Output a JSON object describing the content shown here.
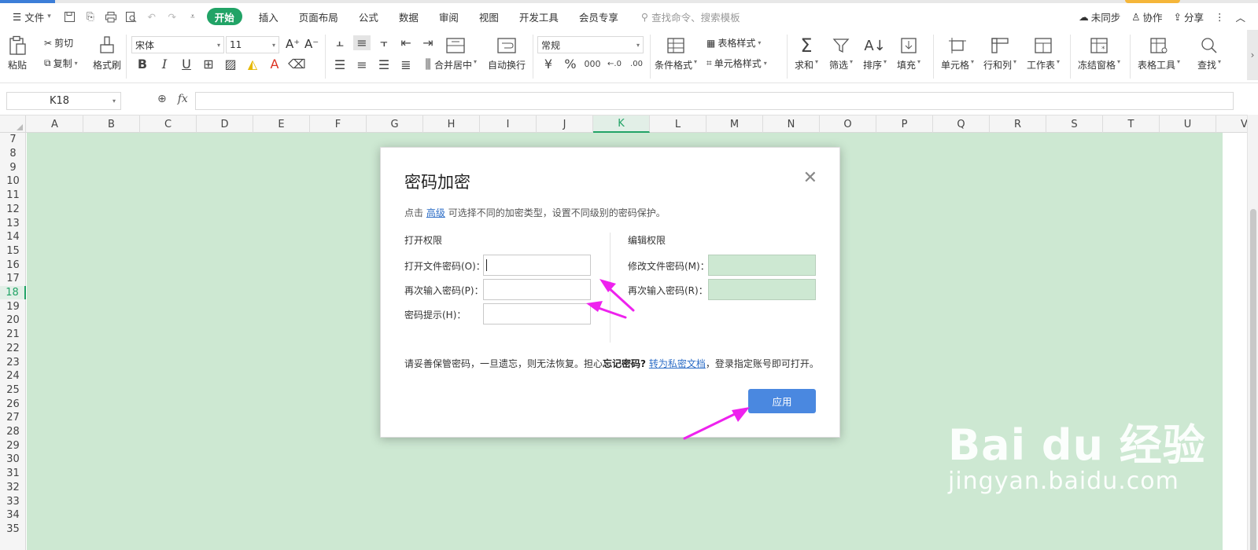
{
  "menu": {
    "file_label": "文件",
    "tabs": [
      "开始",
      "插入",
      "页面布局",
      "公式",
      "数据",
      "审阅",
      "视图",
      "开发工具",
      "会员专享"
    ],
    "search_placeholder": "查找命令、搜索模板",
    "sync_label": "未同步",
    "collab_label": "协作",
    "share_label": "分享"
  },
  "ribbon": {
    "paste": "粘贴",
    "cut": "剪切",
    "copy": "复制",
    "format_painter": "格式刷",
    "font_name": "宋体",
    "font_size": "11",
    "merge_center": "合并居中",
    "wrap_text": "自动换行",
    "number_format": "常规",
    "conditional_format": "条件格式",
    "table_style": "表格样式",
    "cell_style": "单元格样式",
    "sum": "求和",
    "filter": "筛选",
    "sort": "排序",
    "fill": "填充",
    "cell": "单元格",
    "rows_cols": "行和列",
    "worksheet": "工作表",
    "freeze": "冻结窗格",
    "table_tools": "表格工具",
    "find": "查找"
  },
  "formula_bar": {
    "name_box": "K18",
    "fx": "fx",
    "formula": ""
  },
  "grid": {
    "columns": [
      "A",
      "B",
      "C",
      "D",
      "E",
      "F",
      "G",
      "H",
      "I",
      "J",
      "K",
      "L",
      "M",
      "N",
      "O",
      "P",
      "Q",
      "R",
      "S",
      "T",
      "U",
      "V"
    ],
    "rows": [
      "7",
      "8",
      "9",
      "10",
      "11",
      "12",
      "13",
      "14",
      "15",
      "16",
      "17",
      "18",
      "19",
      "20",
      "21",
      "22",
      "23",
      "24",
      "25",
      "26",
      "27",
      "28",
      "29",
      "30",
      "31",
      "32",
      "33",
      "34",
      "35"
    ],
    "selected_column": "K",
    "selected_row": "18"
  },
  "dialog": {
    "title": "密码加密",
    "subtitle_prefix": "点击",
    "subtitle_link": "高级",
    "subtitle_suffix": "可选择不同的加密类型，设置不同级别的密码保护。",
    "open_section": "打开权限",
    "edit_section": "编辑权限",
    "open_password_label": "打开文件密码(O)：",
    "open_password_confirm_label": "再次输入密码(P)：",
    "password_hint_label": "密码提示(H)：",
    "edit_password_label": "修改文件密码(M)：",
    "edit_password_confirm_label": "再次输入密码(R)：",
    "note_prefix": "请妥善保管密码，一旦遗忘，则无法恢复。担心",
    "note_bold": "忘记密码?",
    "note_link": "转为私密文档",
    "note_suffix": "，登录指定账号即可打开。",
    "apply_label": "应用"
  },
  "watermark": {
    "line1": "Bai du 经验",
    "line2": "jingyan.baidu.com"
  }
}
